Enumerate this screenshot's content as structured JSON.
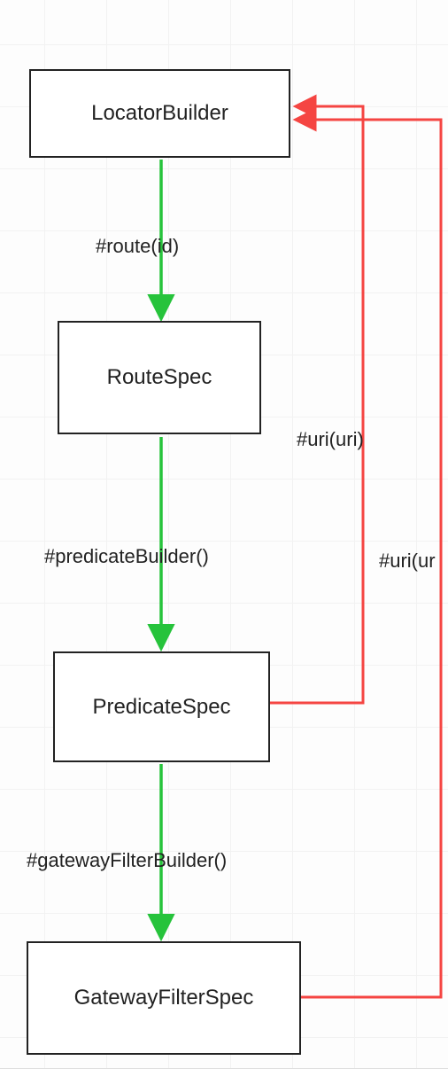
{
  "nodes": {
    "locatorBuilder": "LocatorBuilder",
    "routeSpec": "RouteSpec",
    "predicateSpec": "PredicateSpec",
    "gatewayFilterSpec": "GatewayFilterSpec"
  },
  "edges": {
    "routeId": "#route(id)",
    "predicateBuilder": "#predicateBuilder()",
    "gatewayFilterBuilder": "#gatewayFilterBuilder()",
    "uriUri": "#uri(uri)",
    "uriUrPartial": "#uri(ur"
  },
  "colors": {
    "green": "#26c33b",
    "red": "#f54542",
    "stroke": "#222222"
  }
}
